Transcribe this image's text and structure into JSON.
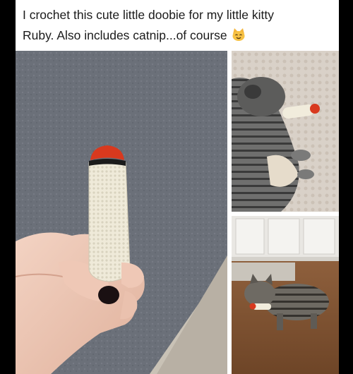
{
  "post": {
    "caption_line1": "I crochet this cute little doobie for my little kitty",
    "caption_line2": "Ruby. Also includes catnip...of course",
    "emoji": "cat-face-emoji"
  },
  "photos": [
    {
      "name": "photo-hand-holding-crochet-joint",
      "icon": "photo"
    },
    {
      "name": "photo-kitten-with-toy",
      "icon": "photo"
    },
    {
      "name": "photo-cat-carrying-toy",
      "icon": "photo"
    }
  ],
  "colors": {
    "page_bg": "#000000",
    "card_bg": "#ffffff",
    "text": "#1b1b1b",
    "toy_tip": "#d8391e",
    "toy_body": "#eeeadb"
  }
}
